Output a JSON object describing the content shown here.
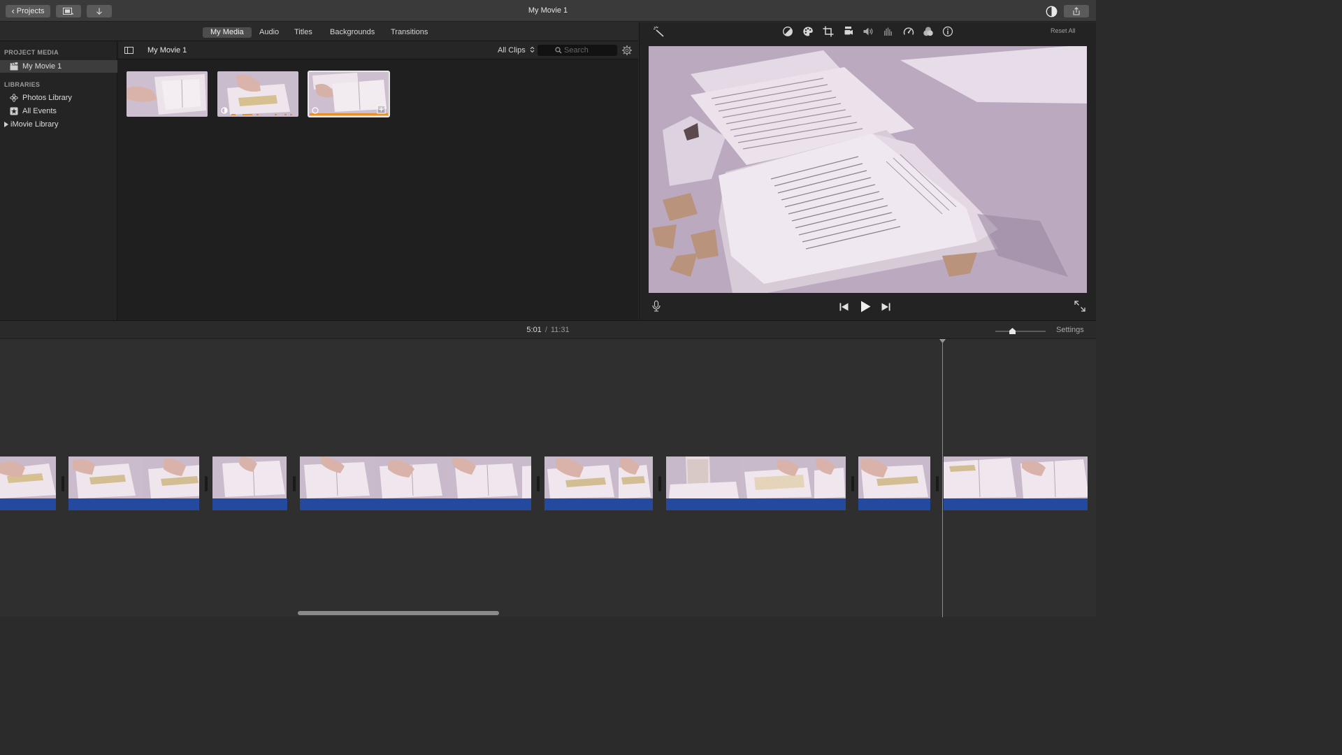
{
  "window": {
    "title": "My Movie 1"
  },
  "toolbar": {
    "projects_label": "Projects",
    "media_icon": "filmstrip-icon",
    "import_icon": "import-arrow-icon",
    "contrast_icon": "contrast-icon",
    "share_icon": "share-icon"
  },
  "browser": {
    "tabs": [
      {
        "label": "My Media",
        "active": true
      },
      {
        "label": "Audio",
        "active": false
      },
      {
        "label": "Titles",
        "active": false
      },
      {
        "label": "Backgrounds",
        "active": false
      },
      {
        "label": "Transitions",
        "active": false
      }
    ],
    "sidebar": {
      "project_header": "PROJECT MEDIA",
      "project_item": "My Movie 1",
      "libraries_header": "LIBRARIES",
      "libraries": [
        "Photos Library",
        "All Events",
        "iMovie Library"
      ]
    },
    "content_title": "My Movie 1",
    "filter": "All Clips",
    "search_placeholder": "Search",
    "clip_count": 3
  },
  "viewer": {
    "reset_label": "Reset All",
    "adjust_tools": [
      "color-balance-icon",
      "color-correction-icon",
      "crop-icon",
      "stabilization-icon",
      "volume-icon",
      "noise-reduction-icon",
      "speed-icon",
      "clip-filter-icon",
      "info-icon"
    ]
  },
  "timeline": {
    "current_time": "5:01",
    "separator": "/",
    "total_time": "11:31",
    "settings_label": "Settings"
  },
  "colors": {
    "audio_bar": "#234a9e",
    "selection_outline": "#e9e9e9",
    "timing_marker": "#e8902b"
  }
}
